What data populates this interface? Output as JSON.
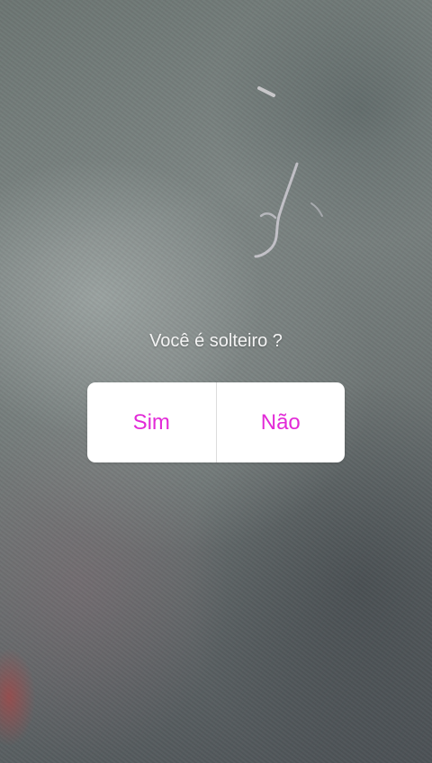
{
  "story": {
    "poll": {
      "question": "Você é solteiro ?",
      "options": [
        {
          "label": "Sim"
        },
        {
          "label": "Não"
        }
      ],
      "option_color": "#e22ad7"
    }
  }
}
